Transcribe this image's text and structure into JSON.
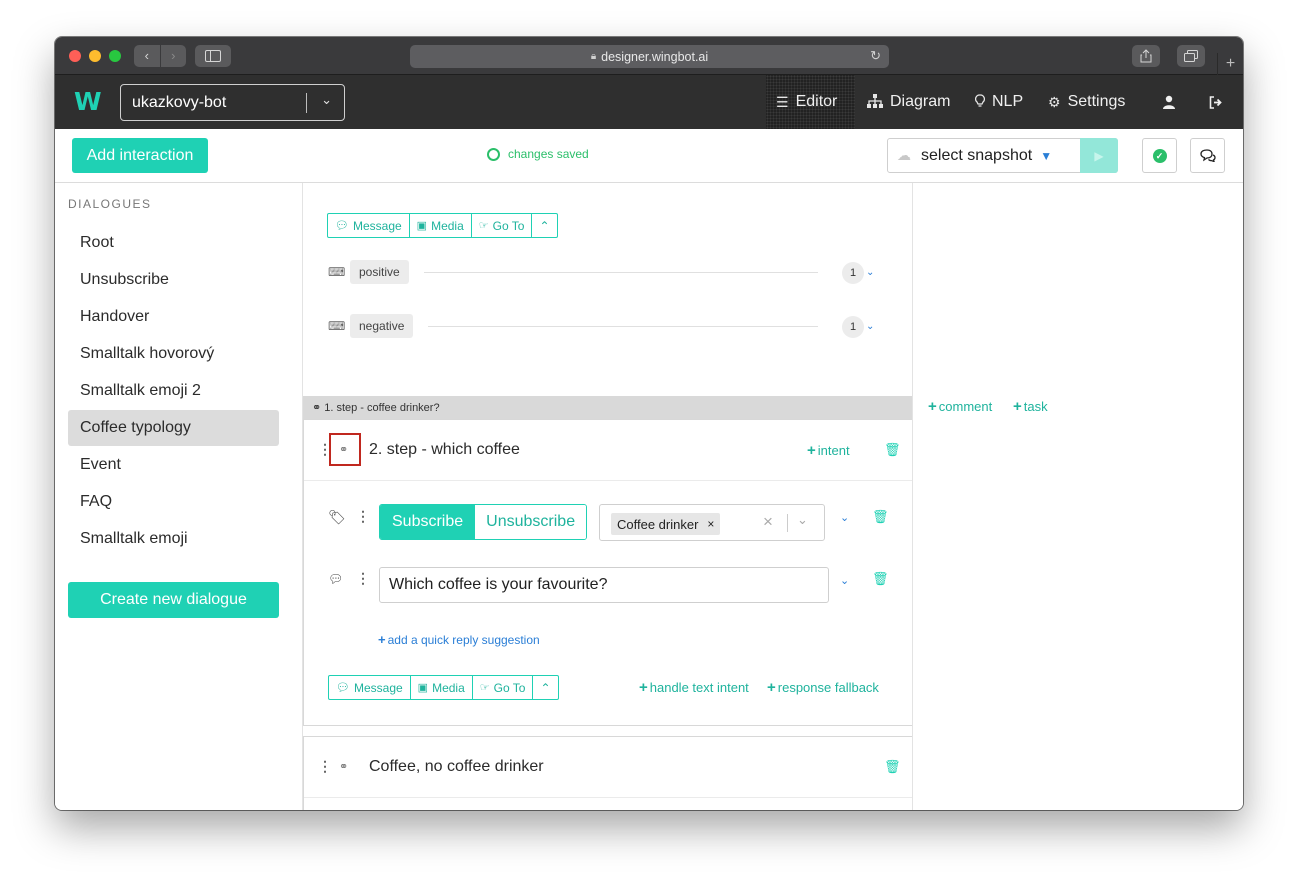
{
  "browser": {
    "url": "designer.wingbot.ai",
    "icons": {
      "lock": "lock-icon",
      "reload": "reload-icon",
      "back": "back-icon",
      "forward": "forward-icon",
      "sidebar": "sidebar-icon",
      "share": "share-icon",
      "tabs": "tabs-icon",
      "new_tab": "plus-icon"
    }
  },
  "app": {
    "logo": "W",
    "bot_name": "ukazkovy-bot",
    "nav": [
      {
        "label": "Editor",
        "icon": "list-icon",
        "active": true
      },
      {
        "label": "Diagram",
        "icon": "sitemap-icon"
      },
      {
        "label": "NLP",
        "icon": "lightbulb-icon"
      },
      {
        "label": "Settings",
        "icon": "gears-icon"
      }
    ],
    "accent": "#1fd1b4"
  },
  "toolbar": {
    "add_interaction": "Add interaction",
    "status": "changes saved",
    "snapshot_placeholder": "select snapshot"
  },
  "sidebar": {
    "title": "DIALOGUES",
    "items": [
      "Root",
      "Unsubscribe",
      "Handover",
      "Smalltalk hovorový",
      "Smalltalk emoji 2",
      "Coffee typology",
      "Event",
      "FAQ",
      "Smalltalk emoji"
    ],
    "active_index": 5,
    "create_button": "Create new dialogue"
  },
  "editor": {
    "actions": {
      "message": "Message",
      "media": "Media",
      "goto": "Go To"
    },
    "intents": [
      {
        "label": "positive",
        "count": "1"
      },
      {
        "label": "negative",
        "count": "1"
      }
    ],
    "parent_step": "1. step - coffee drinker?",
    "step": {
      "title": "2. step - which coffee",
      "intent_link": "intent",
      "subscribe": "Subscribe",
      "unsubscribe": "Unsubscribe",
      "tag": "Coffee drinker",
      "message": "Which coffee is your favourite?",
      "quick_reply": "add a quick reply suggestion",
      "handle_text_intent": "handle text intent",
      "response_fallback": "response fallback"
    },
    "next_card_title": "Coffee, no coffee drinker"
  },
  "right_pane": {
    "comment": "comment",
    "task": "task"
  }
}
